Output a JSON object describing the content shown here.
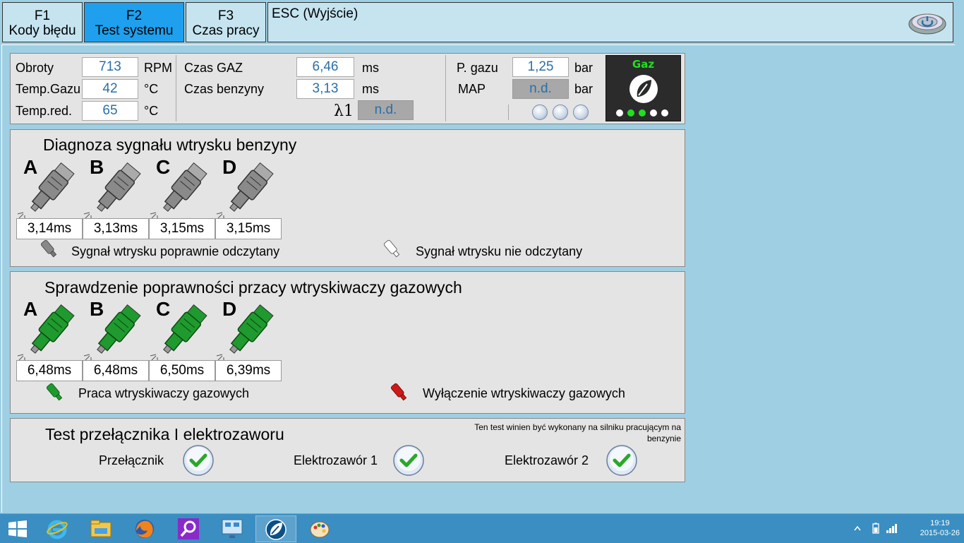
{
  "tabs": [
    {
      "key": "F1",
      "label": "Kody błędu",
      "active": false
    },
    {
      "key": "F2",
      "label": "Test systemu",
      "active": true
    },
    {
      "key": "F3",
      "label": "Czas pracy",
      "active": false
    }
  ],
  "esc_label": "ESC (Wyjście)",
  "readings": {
    "obroty_label": "Obroty",
    "obroty_value": "713",
    "obroty_unit": "RPM",
    "temp_gazu_label": "Temp.Gazu",
    "temp_gazu_value": "42",
    "temp_gazu_unit": "°C",
    "temp_red_label": "Temp.red.",
    "temp_red_value": "65",
    "temp_red_unit": "°C",
    "czas_gaz_label": "Czas GAZ",
    "czas_gaz_value": "6,46",
    "czas_gaz_unit": "ms",
    "czas_benzyny_label": "Czas benzyny",
    "czas_benzyny_value": "3,13",
    "czas_benzyny_unit": "ms",
    "lambda_label": "λ1",
    "lambda_value": "n.d.",
    "p_gazu_label": "P. gazu",
    "p_gazu_value": "1,25",
    "p_gazu_unit": "bar",
    "map_label": "MAP",
    "map_value": "n.d.",
    "map_unit": "bar",
    "gaz_indicator_label": "Gaz"
  },
  "petrol": {
    "title": "Diagnoza sygnału wtrysku benzyny",
    "injectors": [
      {
        "letter": "A",
        "value": "3,14ms"
      },
      {
        "letter": "B",
        "value": "3,13ms"
      },
      {
        "letter": "C",
        "value": "3,15ms"
      },
      {
        "letter": "D",
        "value": "3,15ms"
      }
    ],
    "legend_ok": "Sygnał wtrysku poprawnie odczytany",
    "legend_fail": "Sygnał wtrysku nie odczytany"
  },
  "gas": {
    "title": "Sprawdzenie poprawności przacy wtryskiwaczy gazowych",
    "injectors": [
      {
        "letter": "A",
        "value": "6,48ms"
      },
      {
        "letter": "B",
        "value": "6,48ms"
      },
      {
        "letter": "C",
        "value": "6,50ms"
      },
      {
        "letter": "D",
        "value": "6,39ms"
      }
    ],
    "legend_on": "Praca wtryskiwaczy gazowych",
    "legend_off": "Wyłączenie wtryskiwaczy gazowych"
  },
  "switch_test": {
    "title": "Test przełącznika I elektrozaworu",
    "note": "Ten test winien być wykonany na silniku pracującym na benzynie",
    "items": [
      "Przełącznik",
      "Elektrozawór 1",
      "Elektrozawór 2"
    ]
  },
  "taskbar": {
    "time": "19:19",
    "date": "2015-03-26"
  },
  "colors": {
    "background": "#9fcfe3",
    "tab_active": "#1ea0ee",
    "panel": "#e4e4e4",
    "value_text": "#2a6fa8",
    "gas_injector": "#1f9a2e",
    "petrol_injector": "#8a8a8a",
    "off_injector": "#d01818"
  },
  "icons": [
    "power-icon",
    "gas-indicator-icon",
    "injector-icon",
    "check-icon",
    "windows-icon",
    "ie-icon",
    "explorer-icon",
    "firefox-icon",
    "search-icon",
    "network-icon",
    "app-icon",
    "paint-icon"
  ]
}
